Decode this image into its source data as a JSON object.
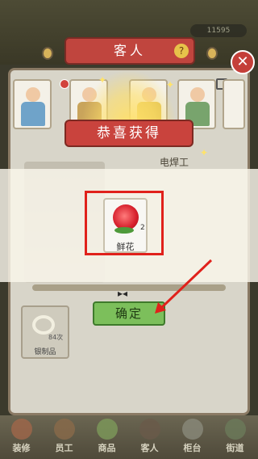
{
  "header": {
    "coins": "11595",
    "title": "客人",
    "help_glyph": "?",
    "close_glyph": "✕"
  },
  "popup": {
    "title": "恭喜获得",
    "job_label": "电焊工",
    "reward": {
      "name": "鲜花",
      "count": "2"
    },
    "confirm_label": "确定"
  },
  "silver_item": {
    "name": "银制品",
    "count": "84次"
  },
  "guests": [
    {
      "body_color": "#6fa3c9"
    },
    {
      "body_color": "#c9a45b"
    },
    {
      "body_color": "#e0c050"
    },
    {
      "body_color": "#78a46d"
    },
    {
      "body_color": "#a67c52"
    }
  ],
  "bottom_nav": [
    {
      "label": "装修"
    },
    {
      "label": "员工"
    },
    {
      "label": "商品"
    },
    {
      "label": "客人"
    },
    {
      "label": "柜台"
    },
    {
      "label": "街道"
    }
  ],
  "colors": {
    "accent_red": "#c9433d",
    "confirm_green": "#7cbf5b",
    "highlight": "#e0211b"
  }
}
